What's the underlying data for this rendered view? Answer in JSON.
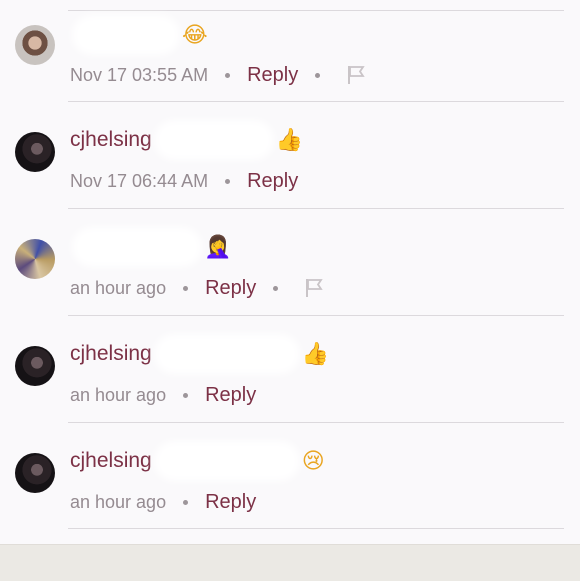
{
  "comments": [
    {
      "username": "",
      "emoji": "😂",
      "timestamp": "Nov 17 03:55 AM",
      "reply_label": "Reply",
      "has_flag": true,
      "avatar": "light"
    },
    {
      "username": "cjhelsing",
      "emoji": "👍",
      "timestamp": "Nov 17 06:44 AM",
      "reply_label": "Reply",
      "has_flag": false,
      "avatar": "dark"
    },
    {
      "username": "",
      "emoji": "🤦‍♀️",
      "timestamp": "an hour ago",
      "reply_label": "Reply",
      "has_flag": true,
      "avatar": "multi"
    },
    {
      "username": "cjhelsing",
      "emoji": "👍",
      "timestamp": "an hour ago",
      "reply_label": "Reply",
      "has_flag": false,
      "avatar": "dark"
    },
    {
      "username": "cjhelsing",
      "emoji": "😢",
      "timestamp": "an hour ago",
      "reply_label": "Reply",
      "has_flag": false,
      "avatar": "dark"
    }
  ],
  "colors": {
    "accent": "#7c3146",
    "meta": "#958b91",
    "background": "#faf9fb",
    "divider": "#dcd9dd",
    "bottom_bar": "#ebe9e4"
  },
  "icons": {
    "flag": "flag-icon",
    "separator": "dot-separator"
  }
}
